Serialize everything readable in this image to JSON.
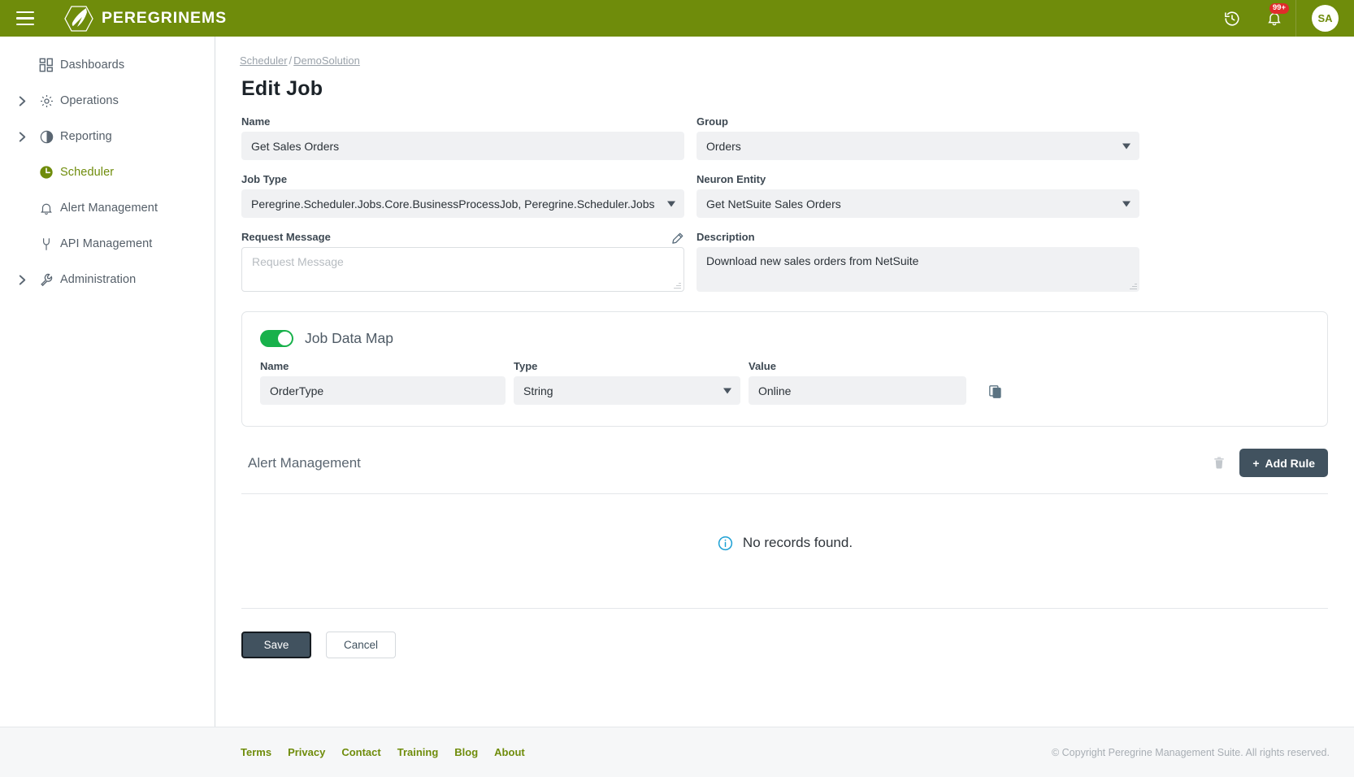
{
  "topbar": {
    "brand": "PEREGRINEMS",
    "menu_icon": "hamburger-icon",
    "history_icon": "history-clock-icon",
    "notification_icon": "bell-icon",
    "notification_badge": "99+",
    "avatar_initials": "SA",
    "brand_color": "#6f8c0b"
  },
  "sidebar": {
    "items": [
      {
        "label": "Dashboards",
        "icon": "dashboard-grid-icon",
        "expandable": false,
        "active": false
      },
      {
        "label": "Operations",
        "icon": "gear-icon",
        "expandable": true,
        "active": false
      },
      {
        "label": "Reporting",
        "icon": "pie-chart-icon",
        "expandable": true,
        "active": false
      },
      {
        "label": "Scheduler",
        "icon": "clock-icon",
        "expandable": false,
        "active": true
      },
      {
        "label": "Alert Management",
        "icon": "bell-icon",
        "expandable": false,
        "active": false
      },
      {
        "label": "API Management",
        "icon": "plug-icon",
        "expandable": false,
        "active": false
      },
      {
        "label": "Administration",
        "icon": "wrench-icon",
        "expandable": true,
        "active": false
      }
    ]
  },
  "breadcrumb": {
    "items": [
      "Scheduler",
      "DemoSolution"
    ],
    "separator": "/"
  },
  "page": {
    "title": "Edit Job"
  },
  "form": {
    "name": {
      "label": "Name",
      "value": "Get Sales Orders"
    },
    "group": {
      "label": "Group",
      "value": "Orders"
    },
    "job_type": {
      "label": "Job Type",
      "value": "Peregrine.Scheduler.Jobs.Core.BusinessProcessJob, Peregrine.Scheduler.Jobs"
    },
    "neuron_entity": {
      "label": "Neuron Entity",
      "value": "Get NetSuite Sales Orders"
    },
    "request_message": {
      "label": "Request Message",
      "value": "",
      "placeholder": "Request Message",
      "edit_icon": "pencil-icon"
    },
    "description": {
      "label": "Description",
      "value": "Download new sales orders from NetSuite"
    }
  },
  "job_data_map": {
    "title": "Job Data Map",
    "enabled": true,
    "toggle_color": "#18b14b",
    "columns": {
      "name": "Name",
      "type": "Type",
      "value": "Value"
    },
    "rows": [
      {
        "name": "OrderType",
        "type": "String",
        "value": "Online",
        "copy_icon": "copy-icon"
      }
    ]
  },
  "alert_management": {
    "title": "Alert Management",
    "delete_icon": "trash-icon",
    "add_rule_label": "Add Rule",
    "add_rule_plus": "+",
    "empty_message": "No records found.",
    "empty_icon": "info-circle-icon"
  },
  "actions": {
    "save_label": "Save",
    "cancel_label": "Cancel"
  },
  "footer": {
    "links": [
      "Terms",
      "Privacy",
      "Contact",
      "Training",
      "Blog",
      "About"
    ],
    "copyright": "© Copyright Peregrine Management Suite. All rights reserved."
  }
}
